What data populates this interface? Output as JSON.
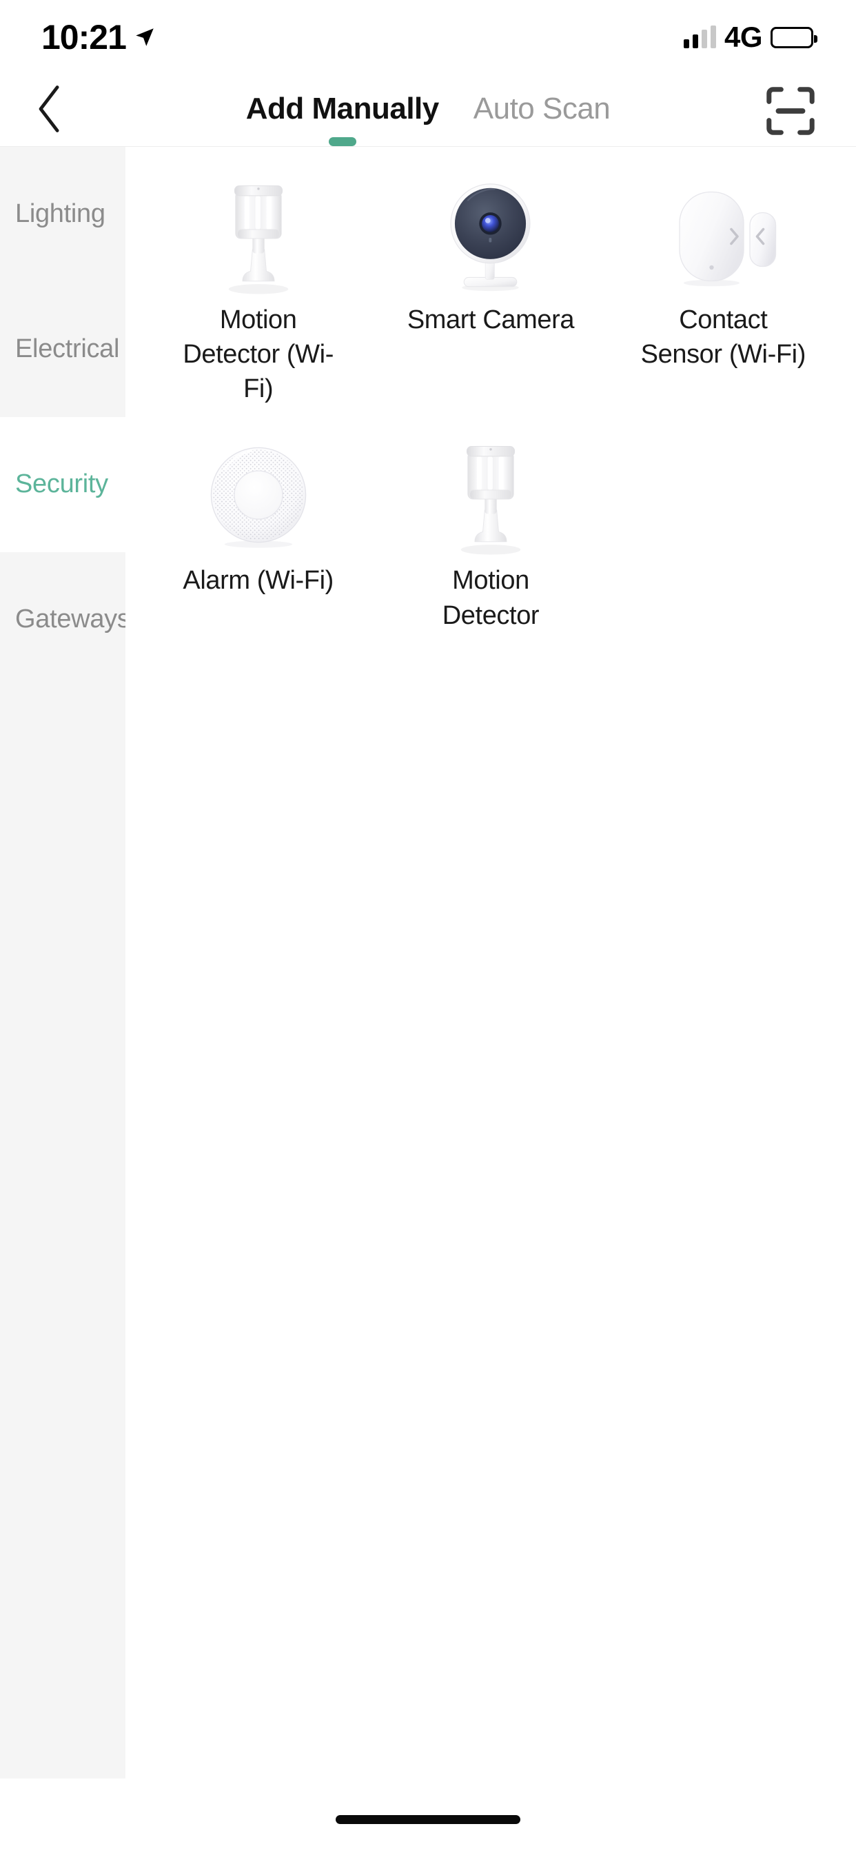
{
  "status_bar": {
    "time": "10:21",
    "location_icon": "location-arrow-icon",
    "signal_icon": "cellular-signal-icon",
    "network": "4G",
    "battery_icon": "battery-icon"
  },
  "header": {
    "back_icon": "chevron-left-icon",
    "scan_icon": "scan-frame-icon",
    "tabs": [
      {
        "label": "Add Manually",
        "active": true
      },
      {
        "label": "Auto Scan",
        "active": false
      }
    ],
    "active_indicator_color": "#4fa88b"
  },
  "sidebar": {
    "items": [
      {
        "label": "Lighting",
        "selected": false
      },
      {
        "label": "Electrical",
        "selected": false
      },
      {
        "label": "Security",
        "selected": true
      },
      {
        "label": "Gateways",
        "selected": false
      }
    ],
    "selected_color": "#5cb49a",
    "unselected_color": "#8b8b8b",
    "unselected_bg": "#f5f5f5"
  },
  "devices": [
    {
      "label": "Motion Detector (Wi-Fi)",
      "icon": "motion-detector-icon"
    },
    {
      "label": "Smart Camera",
      "icon": "smart-camera-icon"
    },
    {
      "label": "Contact Sensor (Wi-Fi)",
      "icon": "contact-sensor-icon"
    },
    {
      "label": "Alarm (Wi-Fi)",
      "icon": "alarm-siren-icon"
    },
    {
      "label": "Motion Detector",
      "icon": "motion-detector-icon"
    }
  ],
  "home_indicator": "home-indicator-bar"
}
